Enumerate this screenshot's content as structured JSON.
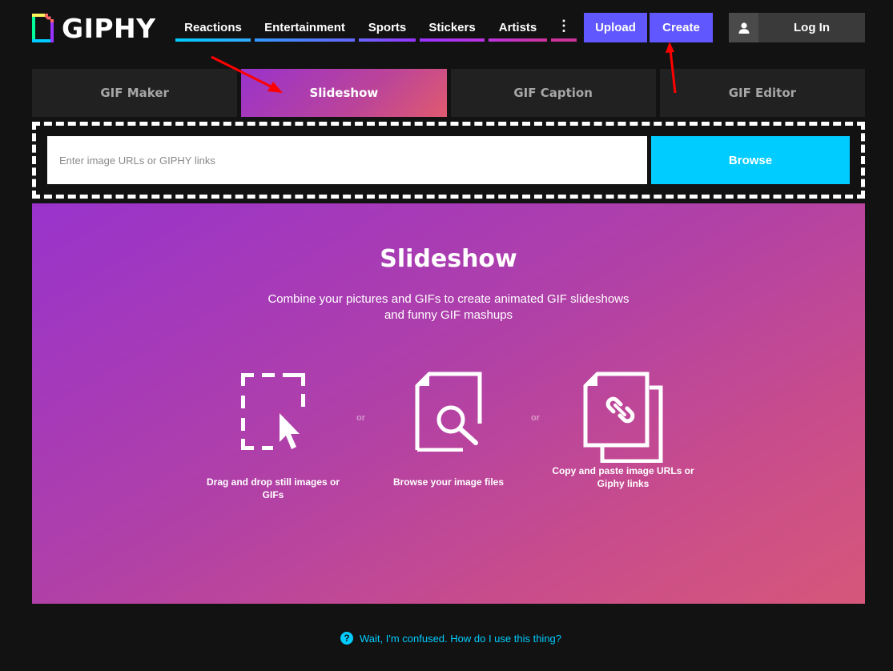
{
  "brand": {
    "name": "GIPHY"
  },
  "nav": {
    "items": [
      {
        "label": "Reactions",
        "color": "#00ccff",
        "color2": "#33aaff"
      },
      {
        "label": "Entertainment",
        "color": "#3399ff",
        "color2": "#6666ff"
      },
      {
        "label": "Sports",
        "color": "#6666ff",
        "color2": "#9933ff"
      },
      {
        "label": "Stickers",
        "color": "#9933ff",
        "color2": "#bb33dd"
      },
      {
        "label": "Artists",
        "color": "#bb33dd",
        "color2": "#cc3399"
      }
    ],
    "more_label": "⋮",
    "more_color": "#cc3399"
  },
  "header": {
    "upload_label": "Upload",
    "create_label": "Create",
    "login_label": "Log In"
  },
  "tabs": [
    {
      "label": "GIF Maker",
      "active": false
    },
    {
      "label": "Slideshow",
      "active": true
    },
    {
      "label": "GIF Caption",
      "active": false
    },
    {
      "label": "GIF Editor",
      "active": false
    }
  ],
  "input": {
    "placeholder": "Enter image URLs or GIPHY links",
    "value": ""
  },
  "browse_label": "Browse",
  "panel": {
    "title": "Slideshow",
    "desc_line1": "Combine your pictures and GIFs to create animated GIF slideshows",
    "desc_line2": "and funny GIF mashups",
    "options": [
      {
        "icon": "drag-drop-icon",
        "line1": "Drag and drop still images or",
        "line2": "GIFs"
      },
      {
        "icon": "browse-file-icon",
        "line1": "Browse your image files",
        "line2": ""
      },
      {
        "icon": "link-files-icon",
        "line1": "Copy and paste image URLs or",
        "line2": "Giphy links"
      }
    ],
    "or_label": "or"
  },
  "help": {
    "label": "Wait, I'm confused. How do I use this thing?"
  },
  "colors": {
    "accent_purple": "#6157ff",
    "accent_cyan": "#00ccff",
    "background": "#121212",
    "tab_inactive": "#212121"
  }
}
